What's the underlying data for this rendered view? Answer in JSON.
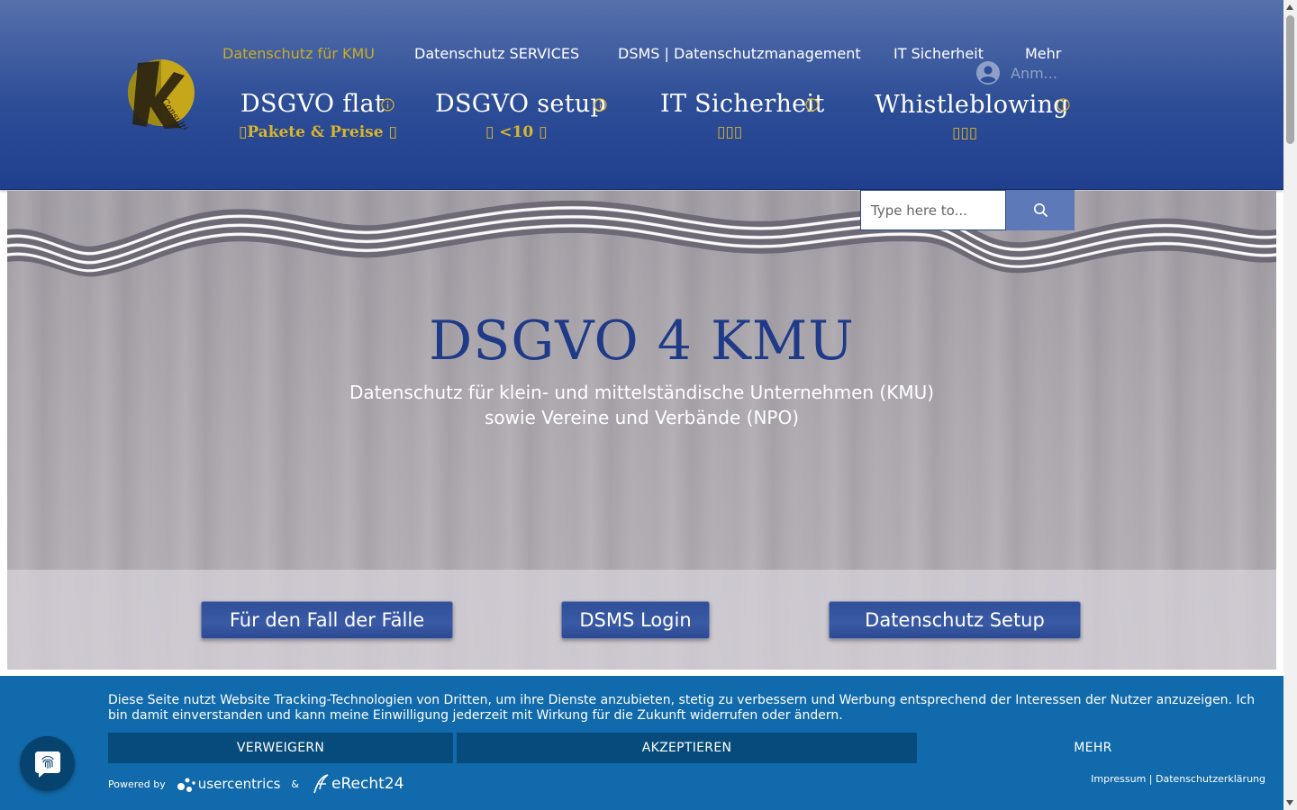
{
  "nav": {
    "items": [
      {
        "label": "Datenschutz für KMU",
        "active": true
      },
      {
        "label": "Datenschutz SERVICES",
        "active": false
      },
      {
        "label": "DSMS | Datenschutzmanagement",
        "active": false
      },
      {
        "label": "IT Sicherheit",
        "active": false
      },
      {
        "label": "Mehr",
        "active": false
      }
    ],
    "login_label": "Anm..."
  },
  "logo": {
    "text": "Consulting",
    "letter": "K"
  },
  "packages": [
    {
      "title": "DSGVO flat",
      "subtitle": "Pakete & Preise ",
      "info_icon": "info-icon"
    },
    {
      "title": "DSGVO setup",
      "subtitle": " <10 ",
      "info_icon": "info-icon"
    },
    {
      "title": "IT Sicherheit",
      "subtitle": "",
      "info_icon": "info-icon"
    },
    {
      "title": "Whistleblowing",
      "subtitle": "",
      "info_icon": "info-icon"
    }
  ],
  "search": {
    "placeholder": "Type here to..."
  },
  "hero": {
    "title": "DSGVO 4 KMU",
    "subtitle_line1": "Datenschutz für klein- und mittelständische Unternehmen (KMU)",
    "subtitle_line2": "sowie Vereine und Verbände (NPO)"
  },
  "cta": [
    {
      "label": "Für den Fall der Fälle"
    },
    {
      "label": "DSMS Login"
    },
    {
      "label": "Datenschutz Setup"
    }
  ],
  "cookie": {
    "text": "Diese Seite nutzt Website Tracking-Technologien von Dritten, um ihre Dienste anzubieten, stetig zu verbessern und Werbung entsprechend der Interessen der Nutzer anzuzeigen. Ich bin damit einverstanden und kann meine Einwilligung jederzeit mit Wirkung für die Zukunft widerrufen oder ändern.",
    "deny": "VERWEIGERN",
    "accept": "AKZEPTIEREN",
    "more": "MEHR",
    "powered_by": "Powered by",
    "brand1": "usercentrics",
    "amp": "&",
    "brand2": "eRecht24",
    "impressum": "Impressum",
    "separator": "|",
    "privacy": "Datenschutzerklärung"
  },
  "colors": {
    "header": "#2d4d97",
    "accent_gold": "#c9ad25",
    "hero_title": "#1f3a87",
    "cookie_bg": "#116aab",
    "cookie_button": "#074b7d"
  }
}
